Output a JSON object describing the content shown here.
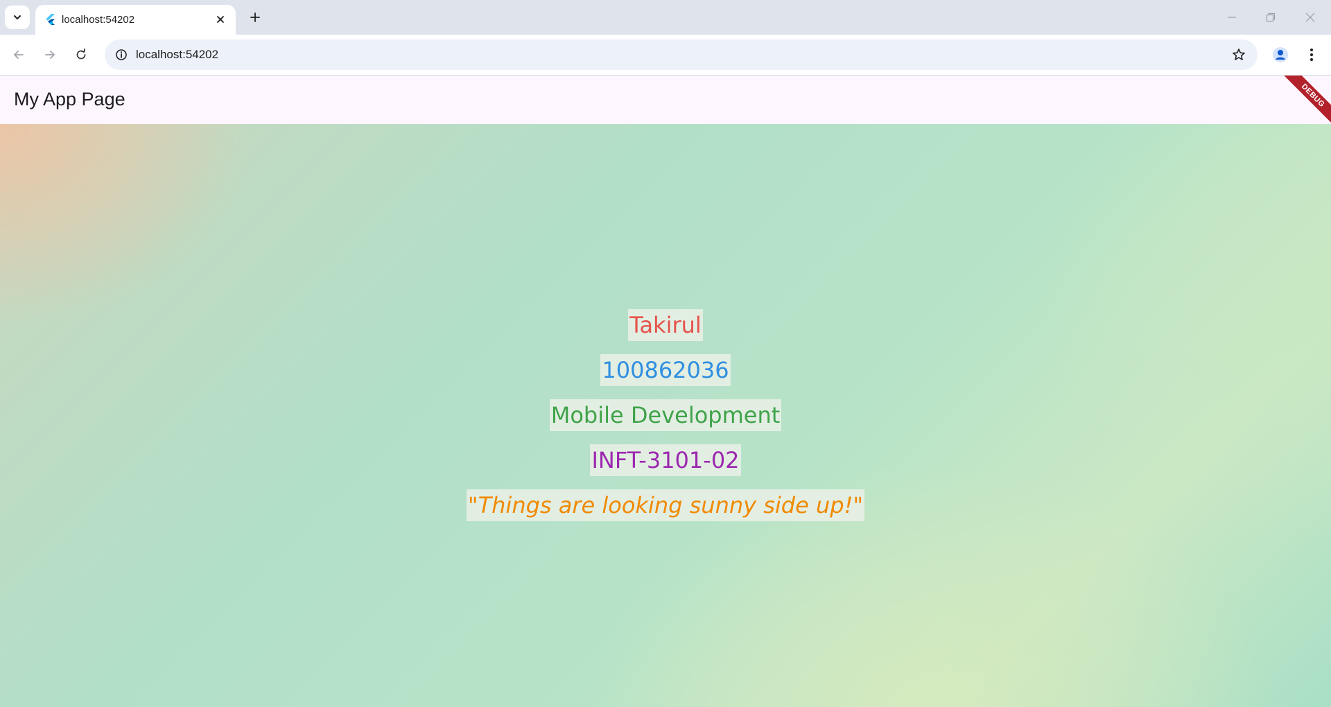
{
  "browser": {
    "tab": {
      "title": "localhost:54202"
    },
    "address_bar": {
      "url": "localhost:54202"
    },
    "icons": {
      "tab_search": "chevron-down-icon",
      "favicon": "flutter-icon",
      "tab_close": "close-icon",
      "new_tab": "plus-icon",
      "back": "arrow-left-icon",
      "forward": "arrow-right-icon",
      "reload": "reload-icon",
      "site_info": "info-icon",
      "bookmark": "star-icon",
      "profile": "person-icon",
      "menu": "kebab-menu-icon",
      "minimize": "minimize-icon",
      "restore": "restore-icon",
      "close_window": "close-icon"
    }
  },
  "app": {
    "app_bar": {
      "title": "My App Page"
    },
    "debug_banner": "DEBUG",
    "info": {
      "name": "Takirul",
      "student_id": "100862036",
      "course": "Mobile Development",
      "section": "INFT-3101-02",
      "quote": "\"Things are looking sunny side up!\""
    },
    "colors": {
      "name": "#e5534b",
      "student_id": "#2f8fe0",
      "course": "#3fa34a",
      "section": "#9c27b0",
      "quote": "#f08a00",
      "app_bar_bg": "#fdf6fe",
      "debug_banner": "#b3222b"
    }
  }
}
